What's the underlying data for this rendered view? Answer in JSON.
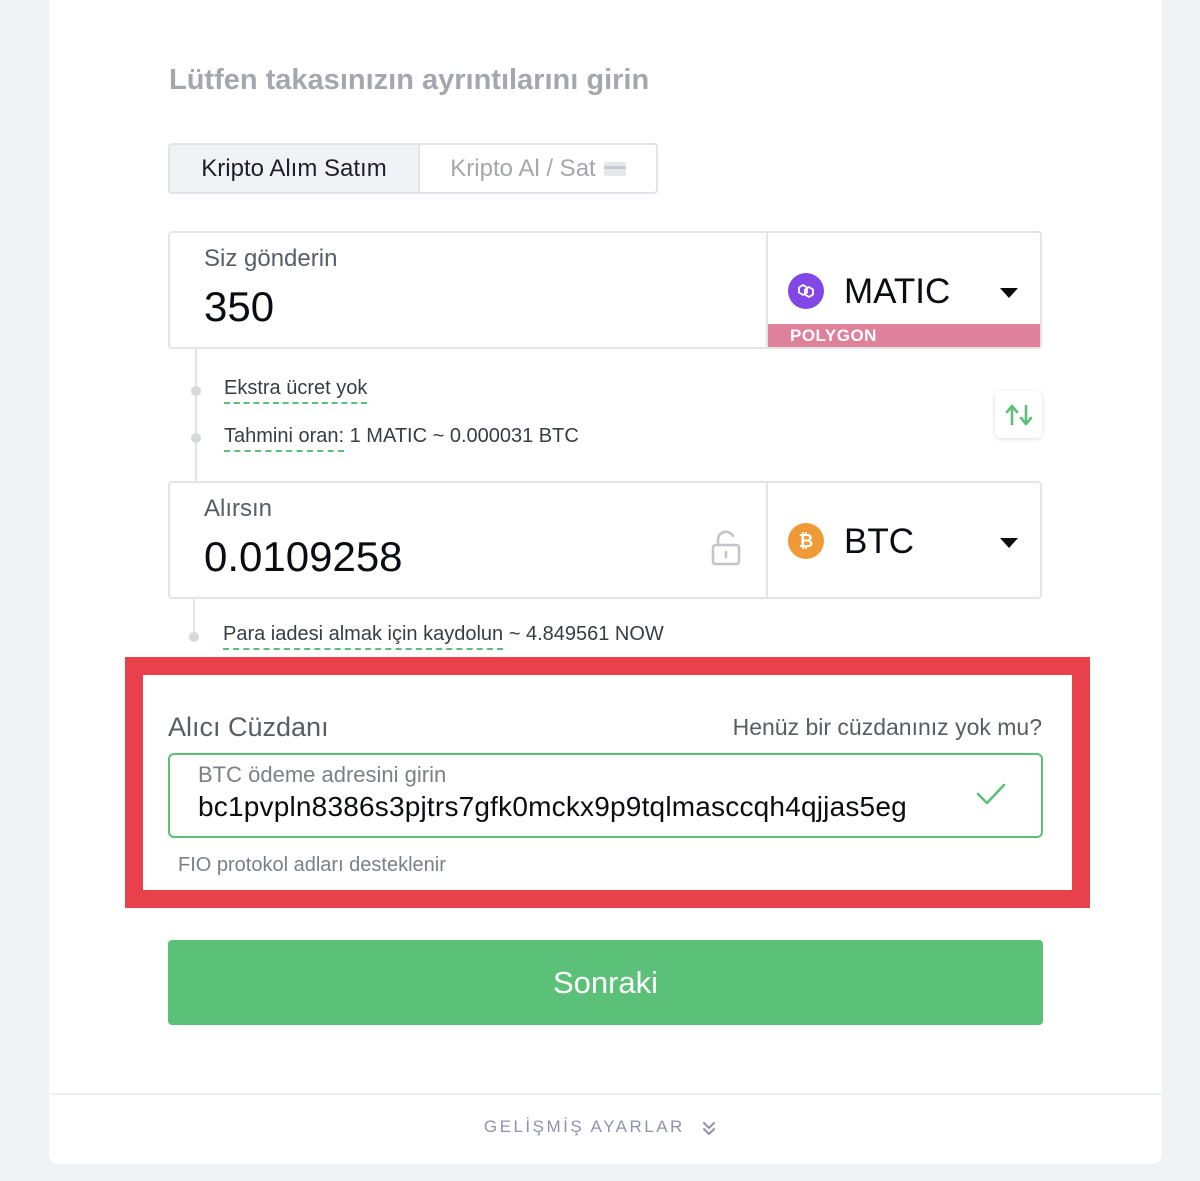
{
  "page": {
    "title": "Lütfen takasınızın ayrıntılarını girin"
  },
  "tabs": [
    {
      "label": "Kripto Alım Satım",
      "active": true
    },
    {
      "label": "Kripto Al / Sat",
      "active": false,
      "icon": "credit-card-icon"
    }
  ],
  "send": {
    "label": "Siz gönderin",
    "amount": "350",
    "currency": "MATIC",
    "network": "POLYGON",
    "icon": "polygon-icon",
    "icon_color": "#8247e5",
    "network_color": "#e0819b"
  },
  "info": {
    "fee": "Ekstra ücret yok",
    "rate_prefix": "Tahmini oran:",
    "rate_value": "1 MATIC ~ 0.000031 BTC"
  },
  "receive": {
    "label": "Alırsın",
    "amount": "0.0109258",
    "currency": "BTC",
    "icon": "bitcoin-icon",
    "icon_color": "#f09a37"
  },
  "refund": {
    "link": "Para iadesi almak için kaydolun",
    "value": "~ 4.849561 NOW"
  },
  "wallet": {
    "label": "Alıcı Cüzdanı",
    "no_wallet_link": "Henüz bir cüzdanınız yok mu?",
    "placeholder": "BTC ödeme adresini girin",
    "address": "bc1pvpln8386s3pjtrs7gfk0mckx9p9tqlmasccqh4qjjas5eg",
    "note": "FIO protokol adları desteklenir"
  },
  "actions": {
    "next": "Sonraki",
    "advanced": "GELİŞMİŞ AYARLAR"
  },
  "colors": {
    "accent_green": "#5bc078",
    "highlight_red": "#e8414b"
  }
}
